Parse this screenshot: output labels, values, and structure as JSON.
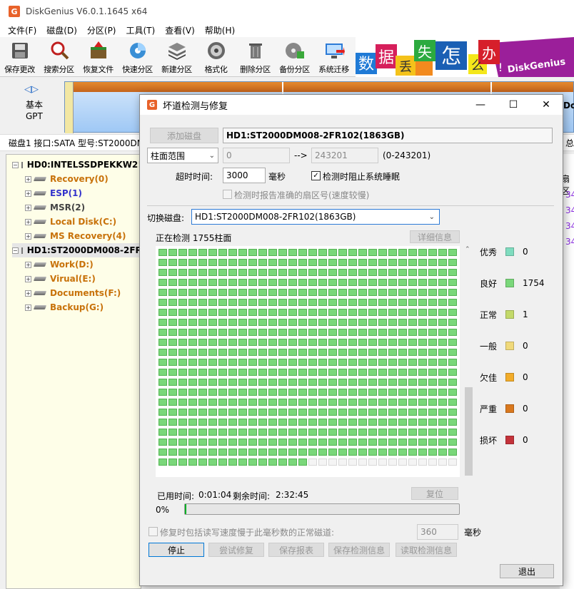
{
  "window": {
    "title": "DiskGenius V6.0.1.1645 x64"
  },
  "menu": [
    "文件(F)",
    "磁盘(D)",
    "分区(P)",
    "工具(T)",
    "查看(V)",
    "帮助(H)"
  ],
  "toolbar": [
    {
      "label": "保存更改",
      "icon": "save-icon"
    },
    {
      "label": "搜索分区",
      "icon": "magnifier-icon"
    },
    {
      "label": "恢复文件",
      "icon": "recover-icon"
    },
    {
      "label": "快速分区",
      "icon": "quick-partition-icon"
    },
    {
      "label": "新建分区",
      "icon": "layers-icon"
    },
    {
      "label": "格式化",
      "icon": "format-icon"
    },
    {
      "label": "删除分区",
      "icon": "trash-icon"
    },
    {
      "label": "备份分区",
      "icon": "backup-icon"
    },
    {
      "label": "系统迁移",
      "icon": "migrate-icon"
    }
  ],
  "banner": {
    "chars": [
      "数",
      "据",
      "丢",
      "失",
      "怎",
      "么",
      "办",
      "!"
    ],
    "brand": "DiskGenius"
  },
  "diskbar": {
    "type_line1": "基本",
    "type_line2": "GPT",
    "partition_label": "Do"
  },
  "infobar": {
    "text": "磁盘1 接口:SATA  型号:ST2000DM",
    "right_char": "总"
  },
  "tree": [
    {
      "label": "HD0:INTELSSDPEKKW2!",
      "kind": "disk",
      "color": "black",
      "indent": 0
    },
    {
      "label": "Recovery(0)",
      "kind": "part",
      "color": "orange",
      "indent": 1
    },
    {
      "label": "ESP(1)",
      "kind": "part",
      "color": "blue",
      "indent": 1
    },
    {
      "label": "MSR(2)",
      "kind": "part",
      "color": "gray",
      "indent": 1
    },
    {
      "label": "Local Disk(C:)",
      "kind": "part",
      "color": "orange",
      "indent": 1
    },
    {
      "label": "MS Recovery(4)",
      "kind": "part",
      "color": "orange",
      "indent": 1
    },
    {
      "label": "HD1:ST2000DM008-2FR",
      "kind": "disk",
      "color": "black",
      "indent": 0,
      "selected": true
    },
    {
      "label": "Work(D:)",
      "kind": "part",
      "color": "orange",
      "indent": 1
    },
    {
      "label": "Virual(E:)",
      "kind": "part",
      "color": "orange",
      "indent": 1
    },
    {
      "label": "Documents(F:)",
      "kind": "part",
      "color": "orange",
      "indent": 1
    },
    {
      "label": "Backup(G:)",
      "kind": "part",
      "color": "orange",
      "indent": 1
    }
  ],
  "right_strip": {
    "header": "扇区",
    "values": [
      "34",
      "34",
      "34",
      "34"
    ]
  },
  "dialog": {
    "title": "坏道检测与修复",
    "add_disk_button": "添加磁盘",
    "disk_name": "HD1:ST2000DM008-2FR102(1863GB)",
    "range_select": "柱面范围",
    "range_from": "0",
    "range_arrow": "-->",
    "range_to": "243201",
    "range_hint": "(0-243201)",
    "timeout_label": "超时时间:",
    "timeout_value": "3000",
    "timeout_unit": "毫秒",
    "prevent_sleep_label": "检测时阻止系统睡眠",
    "report_sector_label": "检测时报告准确的扇区号(速度较慢)",
    "switch_disk_label": "切换磁盘:",
    "switch_disk_value": "HD1:ST2000DM008-2FR102(1863GB)",
    "status_text": "正在检测 1755柱面",
    "details_button": "详细信息",
    "grid": {
      "columns": 30,
      "rows": 22,
      "completed": 645
    },
    "legend": [
      {
        "name": "优秀",
        "count": "0",
        "color": "#7fdcbf"
      },
      {
        "name": "良好",
        "count": "1754",
        "color": "#7ad77a"
      },
      {
        "name": "正常",
        "count": "1",
        "color": "#c3d96a"
      },
      {
        "name": "一般",
        "count": "0",
        "color": "#f0d97a"
      },
      {
        "name": "欠佳",
        "count": "0",
        "color": "#f2ac2a"
      },
      {
        "name": "严重",
        "count": "0",
        "color": "#d9781e"
      },
      {
        "name": "损坏",
        "count": "0",
        "color": "#c3323a"
      }
    ],
    "elapsed_label": "已用时间:",
    "elapsed_value": "0:01:04",
    "remaining_label": "剩余时间:",
    "remaining_value": "2:32:45",
    "reset_button": "复位",
    "progress_text": "0%",
    "progress": 0.4,
    "repair_slow_label": "修复时包括读写速度慢于此毫秒数的正常磁道:",
    "repair_slow_value": "360",
    "repair_slow_unit": "毫秒",
    "stop_button": "停止",
    "try_repair_button": "尝试修复",
    "save_report_button": "保存报表",
    "save_info_button": "保存检测信息",
    "read_info_button": "读取检测信息",
    "exit_button": "退出"
  }
}
